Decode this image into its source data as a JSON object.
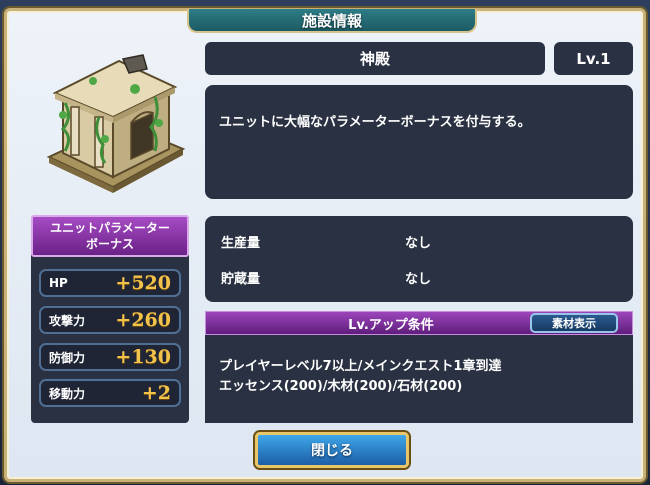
{
  "dialog": {
    "title": "施設情報",
    "close_label": "閉じる"
  },
  "facility": {
    "name": "神殿",
    "level": "Lv.1",
    "description": "ユニットに大幅なパラメーターボーナスを付与する。",
    "image_icon": "temple-ruins-icon"
  },
  "bonus": {
    "header": "ユニットパラメーター\nボーナス",
    "stats": [
      {
        "label": "HP",
        "value": "+520"
      },
      {
        "label": "攻撃力",
        "value": "+260"
      },
      {
        "label": "防御力",
        "value": "+130"
      },
      {
        "label": "移動力",
        "value": "+2"
      }
    ]
  },
  "production": {
    "rows": [
      {
        "label": "生産量",
        "value": "なし"
      },
      {
        "label": "貯蔵量",
        "value": "なし"
      }
    ]
  },
  "levelup": {
    "title": "Lv.アップ条件",
    "material_button": "素材表示",
    "lines": [
      "プレイヤーレベル7以上/メインクエスト1章到達",
      "エッセンス(200)/木材(200)/石材(200)"
    ]
  },
  "colors": {
    "panel_dark": "#2a3142",
    "accent_purple": "#9c45bb",
    "stat_gold": "#f2c24a",
    "button_blue": "#1c5ea6"
  }
}
